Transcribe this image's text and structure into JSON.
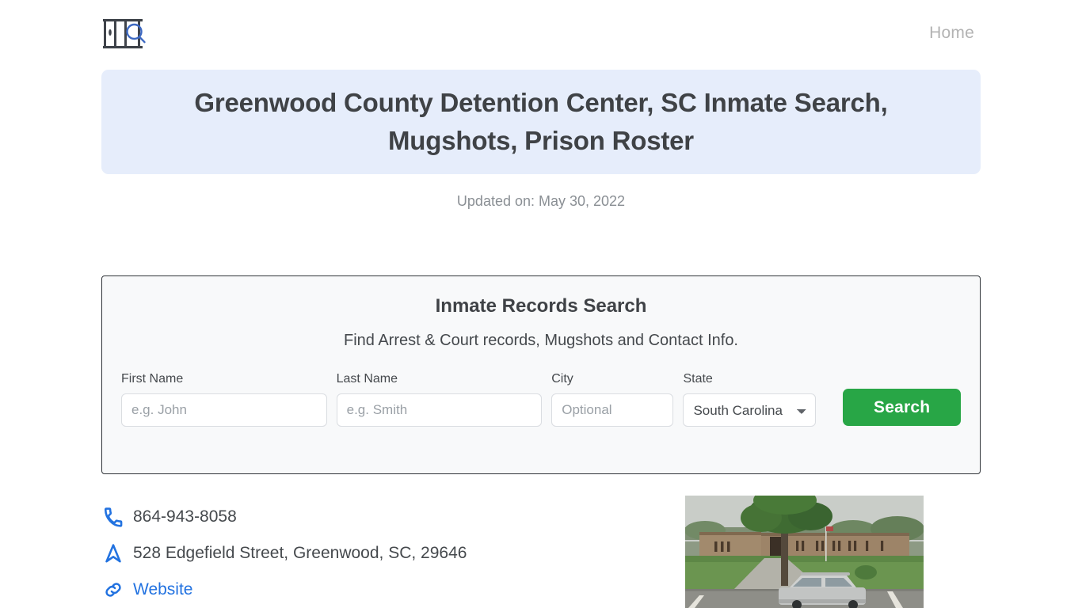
{
  "header": {
    "logo_name": "prison-bars-search-logo",
    "nav": [
      {
        "label": "Home"
      }
    ]
  },
  "banner": {
    "title": "Greenwood County Detention Center, SC Inmate Search, Mugshots, Prison Roster",
    "bg_color": "#e6edfb",
    "text_color": "#3f4246"
  },
  "updated": {
    "text": "Updated on: May 30, 2022"
  },
  "search_panel": {
    "title": "Inmate Records Search",
    "subtitle": "Find Arrest & Court records, Mugshots and Contact Info.",
    "fields": {
      "first_name": {
        "label": "First Name",
        "placeholder": "e.g. John",
        "value": ""
      },
      "last_name": {
        "label": "Last Name",
        "placeholder": "e.g. Smith",
        "value": ""
      },
      "city": {
        "label": "City",
        "placeholder": "Optional",
        "value": ""
      },
      "state": {
        "label": "State",
        "value": "South Carolina"
      }
    },
    "search_button": {
      "label": "Search",
      "color": "#28a646"
    }
  },
  "contact": {
    "phone": {
      "icon": "phone-icon",
      "text": "864-943-8058"
    },
    "address": {
      "icon": "navigation-arrow-icon",
      "text": "528 Edgefield Street, Greenwood, SC, 29646"
    },
    "website": {
      "icon": "link-icon",
      "text": "Website",
      "color": "#2272e0"
    }
  },
  "photo": {
    "alt": "Greenwood County Detention Center building exterior street view"
  }
}
